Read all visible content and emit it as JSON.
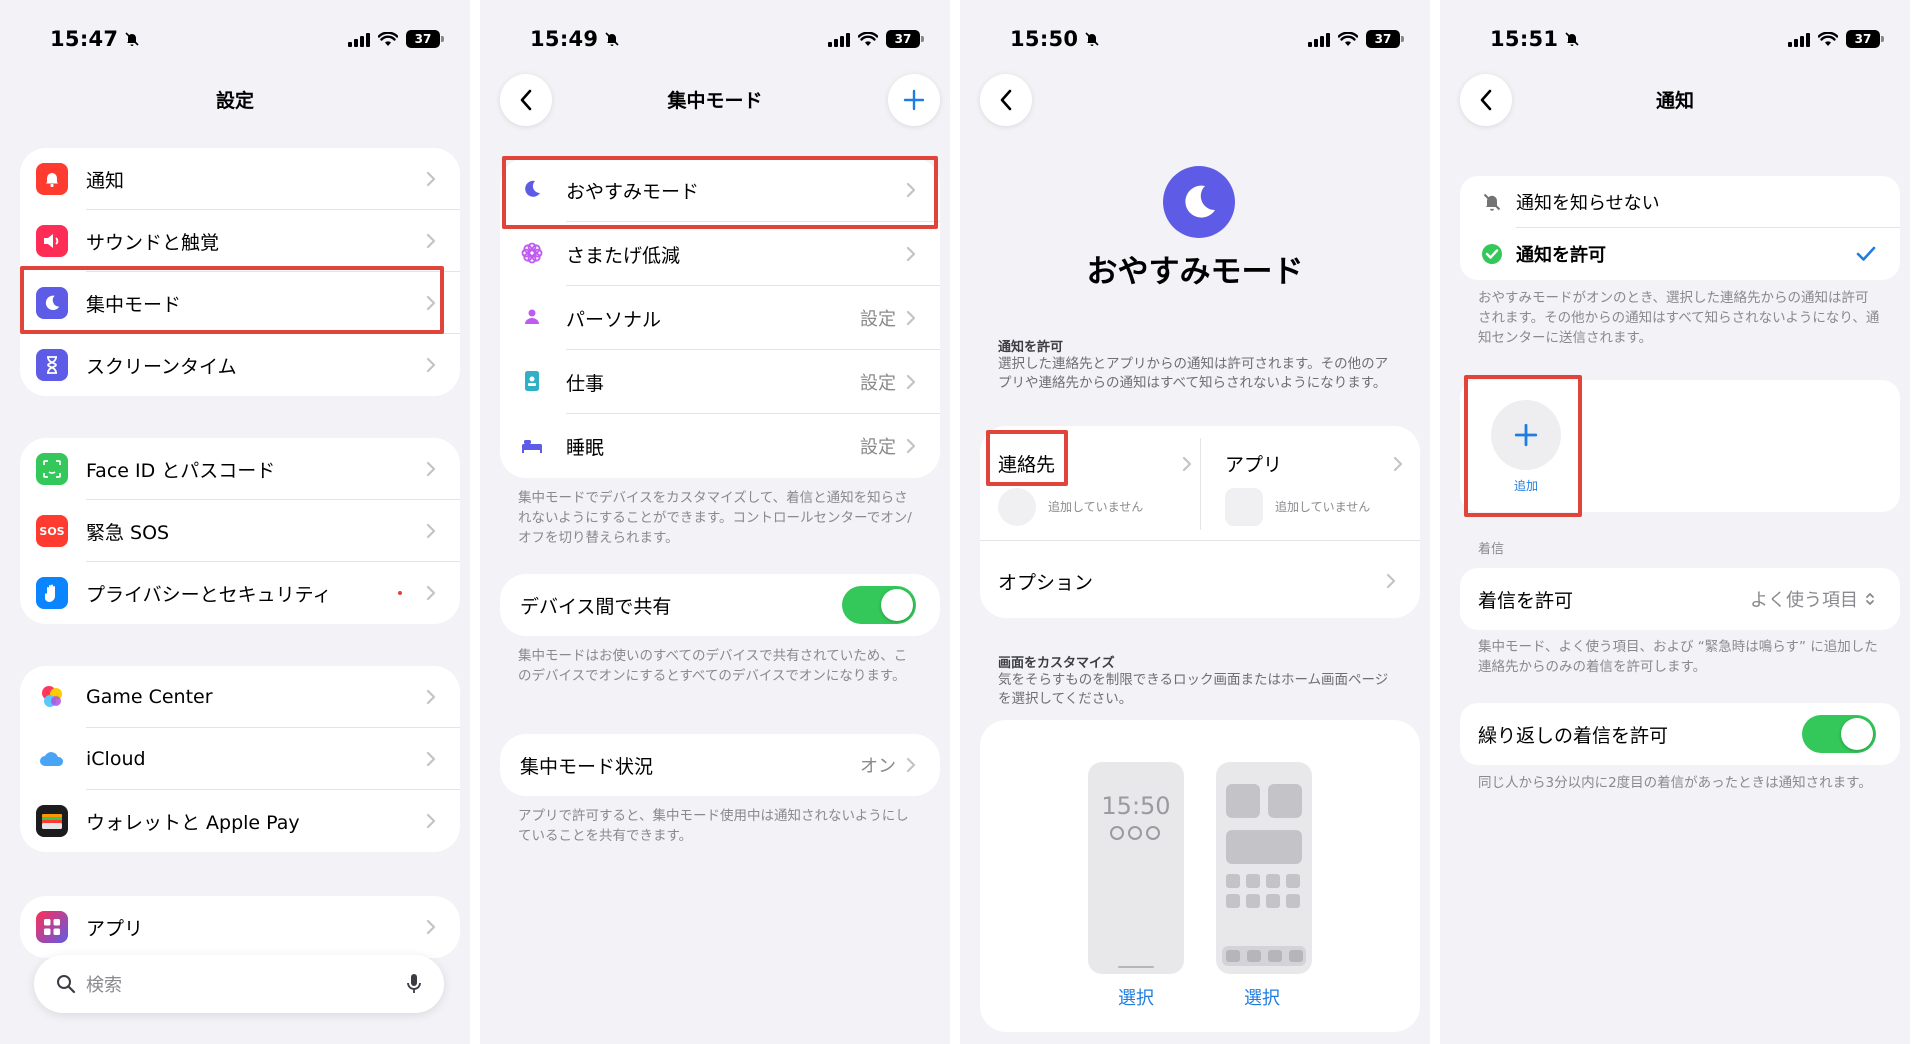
{
  "status": {
    "times": [
      "15:47",
      "15:49",
      "15:50",
      "15:51"
    ],
    "battery": "37"
  },
  "panel1": {
    "title": "設定",
    "group1": [
      "通知",
      "サウンドと触覚",
      "集中モード",
      "スクリーンタイム"
    ],
    "group2": [
      "Face ID とパスコード",
      "緊急 SOS",
      "プライバシーとセキュリティ"
    ],
    "group3": [
      "Game Center",
      "iCloud",
      "ウォレットと Apple Pay"
    ],
    "group4": [
      "アプリ"
    ],
    "sos_icon_text": "SOS",
    "search_placeholder": "検索"
  },
  "panel2": {
    "title": "集中モード",
    "modes": [
      {
        "label": "おやすみモード",
        "value": ""
      },
      {
        "label": "さまたげ低減",
        "value": ""
      },
      {
        "label": "パーソナル",
        "value": "設定"
      },
      {
        "label": "仕事",
        "value": "設定"
      },
      {
        "label": "睡眠",
        "value": "設定"
      }
    ],
    "modes_footnote": "集中モードでデバイスをカスタマイズして、着信と通知を知らされないようにすることができます。コントロールセンターでオン/オフを切り替えられます。",
    "share_label": "デバイス間で共有",
    "share_footnote": "集中モードはお使いのすべてのデバイスで共有されていため、このデバイスでオンにするとすべてのデバイスでオンになります。",
    "status_label": "集中モード状況",
    "status_value": "オン",
    "status_footnote": "アプリで許可すると、集中モード使用中は通知されないようにしていることを共有できます。"
  },
  "panel3": {
    "title": "おやすみモード",
    "allow_heading": "通知を許可",
    "allow_text": "選択した連絡先とアプリからの通知は許可されます。その他のアプリや連絡先からの通知はすべて知らされないようになります。",
    "contacts_label": "連絡先",
    "contacts_sub": "追加していません",
    "apps_label": "アプリ",
    "apps_sub": "追加していません",
    "options_label": "オプション",
    "customize_heading": "画面をカスタマイズ",
    "customize_text": "気をそらすものを制限できるロック画面またはホーム画面ページを選択してください。",
    "lock_time": "15:50",
    "select_label_1": "選択",
    "select_label_2": "選択"
  },
  "panel4": {
    "title": "通知",
    "option_off": "通知を知らせない",
    "option_on": "通知を許可",
    "allow_footnote": "おやすみモードがオンのとき、選択した連絡先からの通知は許可されます。その他からの通知はすべて知らされないようになり、通知センターに送信されます。",
    "add_label": "追加",
    "calls_heading": "着信",
    "calls_label": "着信を許可",
    "calls_value": "よく使う項目",
    "calls_footnote": "集中モード、よく使う項目、および “緊急時は鳴らす” に追加した連絡先からのみの着信を許可します。",
    "repeat_label": "繰り返しの着信を許可",
    "repeat_footnote": "同じ人から3分以内に2度目の着信があったときは通知されます。"
  }
}
